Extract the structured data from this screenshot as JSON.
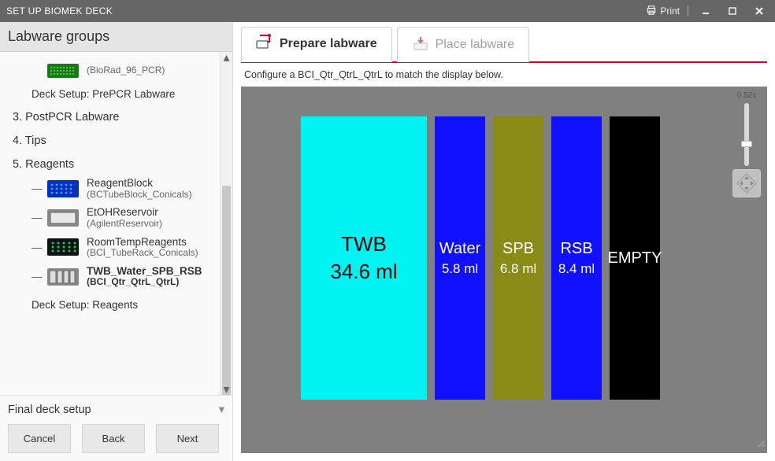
{
  "titlebar": {
    "title": "SET UP BIOMEK DECK",
    "print": "Print"
  },
  "sidebar": {
    "title": "Labware groups",
    "truncated_top": {
      "sub": "(BioRad_96_PCR)"
    },
    "deck_setup_prepcr": "Deck Setup: PrePCR Labware",
    "sections": {
      "s3": "3. PostPCR Labware",
      "s4": "4. Tips",
      "s5": "5. Reagents"
    },
    "reagents": [
      {
        "primary": "ReagentBlock",
        "secondary": "(BCTubeBlock_Conicals)",
        "icon": "reagent-block"
      },
      {
        "primary": "EtOHReservoir",
        "secondary": "(AgilentReservoir)",
        "icon": "reservoir"
      },
      {
        "primary": "RoomTempReagents",
        "secondary": "(BCI_TubeRack_Conicals)",
        "icon": "tuberack"
      },
      {
        "primary": "TWB_Water_SPB_RSB",
        "secondary": "(BCI_Qtr_QtrL_QtrL)",
        "icon": "quarter-reservoir"
      }
    ],
    "deck_setup_reagents": "Deck Setup: Reagents",
    "final": "Final deck setup"
  },
  "buttons": {
    "cancel": "Cancel",
    "back": "Back",
    "next": "Next"
  },
  "tabs": {
    "prepare": "Prepare labware",
    "place": "Place labware"
  },
  "instruction": "Configure a BCI_Qtr_QtrL_QtrL to match the display below.",
  "zoom": {
    "value": "0.52x"
  },
  "wells": [
    {
      "label": "TWB",
      "vol": "34.6 ml",
      "color": "#00f2f2",
      "text": "#000000",
      "size": "big"
    },
    {
      "label": "Water",
      "vol": "5.8 ml",
      "color": "#1010ff",
      "text": "#ffffff",
      "size": "small"
    },
    {
      "label": "SPB",
      "vol": "6.8 ml",
      "color": "#8a8a17",
      "text": "#ffffff",
      "size": "small"
    },
    {
      "label": "RSB",
      "vol": "8.4 ml",
      "color": "#1010ff",
      "text": "#ffffff",
      "size": "small"
    },
    {
      "label": "EMPTY",
      "vol": "",
      "color": "#000000",
      "text": "#ffffff",
      "size": "small"
    }
  ]
}
